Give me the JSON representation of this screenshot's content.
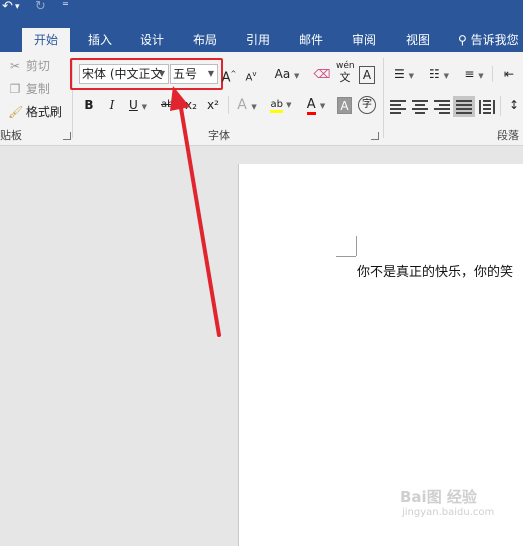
{
  "qat": {
    "undo": "↶",
    "undo_dropdown": "▾",
    "redo": "↻",
    "customize": "⁼"
  },
  "tabs": [
    "开始",
    "插入",
    "设计",
    "布局",
    "引用",
    "邮件",
    "审阅",
    "视图"
  ],
  "tell_me": "告诉我您",
  "clipboard": {
    "cut": "剪切",
    "copy": "复制",
    "format_painter": "格式刷",
    "group_label": "贴板"
  },
  "font": {
    "font_name": "宋体 (中文正文",
    "font_size": "五号",
    "group_label": "字体",
    "grow": "A",
    "shrink": "A",
    "change_case": "Aa",
    "pinyin_top": "wén",
    "pinyin_bottom": "文",
    "char_border": "A",
    "bold": "B",
    "italic": "I",
    "underline": "U",
    "strike": "abc",
    "subscript": "x₂",
    "superscript": "x²",
    "text_effects": "A",
    "highlight": "ab",
    "font_color": "A",
    "char_shading": "A",
    "enclose": "字"
  },
  "paragraph": {
    "group_label": "段落"
  },
  "document": {
    "text": "你不是真正的快乐，你的笑"
  },
  "watermark": {
    "line1": "Bai图 经验",
    "line2": "jingyan.baidu.com"
  },
  "colors": {
    "ribbon_blue": "#2b579a",
    "annotation_red": "#e1252f",
    "highlight_yellow": "#ffff00",
    "font_red": "#ff0000"
  }
}
